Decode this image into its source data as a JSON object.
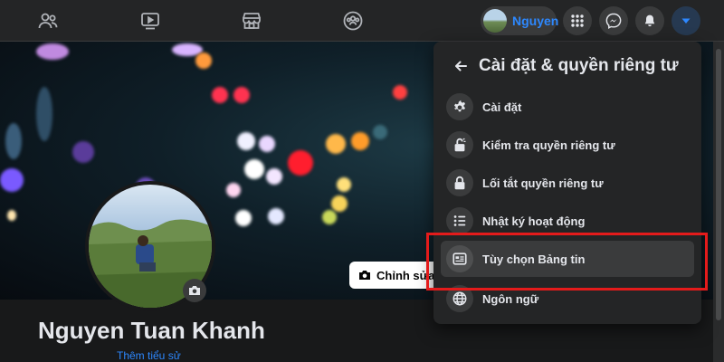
{
  "nav": {
    "icons": [
      "friends-icon",
      "watch-icon",
      "marketplace-icon",
      "groups-icon"
    ],
    "profile_name": "Nguyen",
    "right_buttons": [
      "menu-grid-icon",
      "messenger-icon",
      "notifications-bell-icon",
      "account-caret-icon"
    ],
    "accent": "#2d88ff"
  },
  "cover": {
    "edit_label": "Chỉnh sửa ả"
  },
  "profile": {
    "name": "Nguyen Tuan Khanh",
    "add_bio": "Thêm tiểu sử"
  },
  "dropdown": {
    "title": "Cài đặt & quyền riêng tư",
    "items": [
      {
        "label": "Cài đặt",
        "icon": "gear-icon"
      },
      {
        "label": "Kiểm tra quyền riêng tư",
        "icon": "lock-open-icon"
      },
      {
        "label": "Lối tắt quyền riêng tư",
        "icon": "lock-icon"
      },
      {
        "label": "Nhật ký hoạt động",
        "icon": "list-icon"
      },
      {
        "label": "Tùy chọn Bảng tin",
        "icon": "news-feed-icon",
        "highlighted": true
      },
      {
        "label": "Ngôn ngữ",
        "icon": "globe-icon"
      }
    ],
    "highlight_color": "#e41b1b"
  }
}
